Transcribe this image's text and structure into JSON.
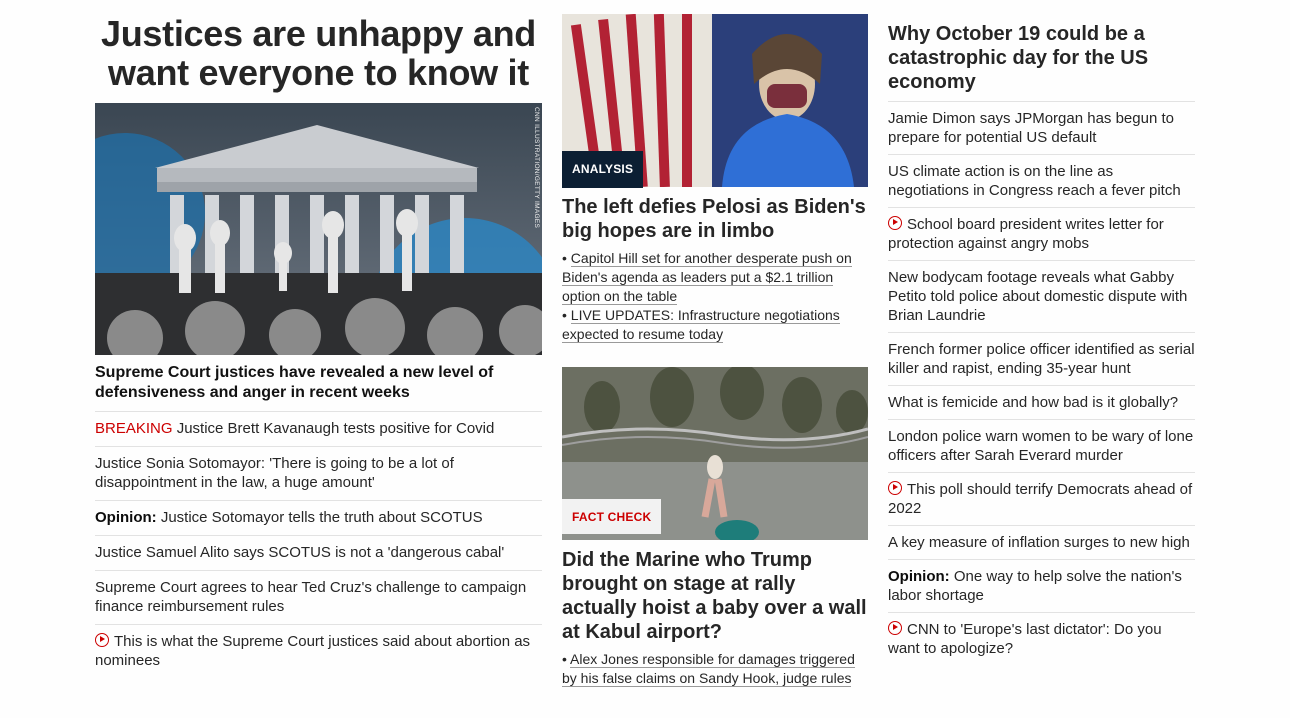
{
  "left": {
    "hero_title": "Justices are unhappy and want everyone to know it",
    "image_credit": "CNN ILLUSTRATION/GETTY IMAGES",
    "hero_sub": "Supreme Court justices have revealed a new level of defensiveness and anger in recent weeks",
    "items": [
      {
        "tag": "BREAKING",
        "text": "Justice Brett Kavanaugh tests positive for Covid"
      },
      {
        "text": "Justice Sonia Sotomayor: 'There is going to be a lot of disappointment in the law, a huge amount'"
      },
      {
        "prefix": "Opinion:",
        "text": "Justice Sotomayor tells the truth about SCOTUS"
      },
      {
        "text": "Justice Samuel Alito says SCOTUS is not a 'dangerous cabal'"
      },
      {
        "text": "Supreme Court agrees to hear Ted Cruz's challenge to campaign finance reimbursement rules"
      },
      {
        "video": true,
        "text": "This is what the Supreme Court justices said about abortion as nominees"
      }
    ]
  },
  "middle": {
    "card1": {
      "label": "ANALYSIS",
      "title": "The left defies Pelosi as Biden's big hopes are in limbo",
      "bullets": [
        "Capitol Hill set for another desperate push on Biden's agenda as leaders put a $2.1 trillion option on the table",
        "LIVE UPDATES: Infrastructure negotiations expected to resume today"
      ]
    },
    "card2": {
      "label": "FACT CHECK",
      "title": "Did the Marine who Trump brought on stage at rally actually hoist a baby over a wall at Kabul airport?",
      "bullets": [
        "Alex Jones responsible for damages triggered by his false claims on Sandy Hook, judge rules"
      ]
    }
  },
  "right": {
    "title": "Why October 19 could be a catastrophic day for the US economy",
    "items": [
      {
        "text": "Jamie Dimon says JPMorgan has begun to prepare for potential US default"
      },
      {
        "text": "US climate action is on the line as negotiations in Congress reach a fever pitch"
      },
      {
        "video": true,
        "text": "School board president writes letter for protection against angry mobs"
      },
      {
        "text": "New bodycam footage reveals what Gabby Petito told police about domestic dispute with Brian Laundrie"
      },
      {
        "text": "French former police officer identified as serial killer and rapist, ending 35-year hunt"
      },
      {
        "text": "What is femicide and how bad is it globally?"
      },
      {
        "text": "London police warn women to be wary of lone officers after Sarah Everard murder"
      },
      {
        "video": true,
        "text": "This poll should terrify Democrats ahead of 2022"
      },
      {
        "text": "A key measure of inflation surges to new high"
      },
      {
        "prefix": "Opinion:",
        "text": "One way to help solve the nation's labor shortage"
      },
      {
        "video": true,
        "text": "CNN to 'Europe's last dictator': Do you want to apologize?"
      }
    ]
  },
  "colors": {
    "breaking": "#cc0000",
    "label_dark": "#0c1f33",
    "text": "#262626"
  }
}
